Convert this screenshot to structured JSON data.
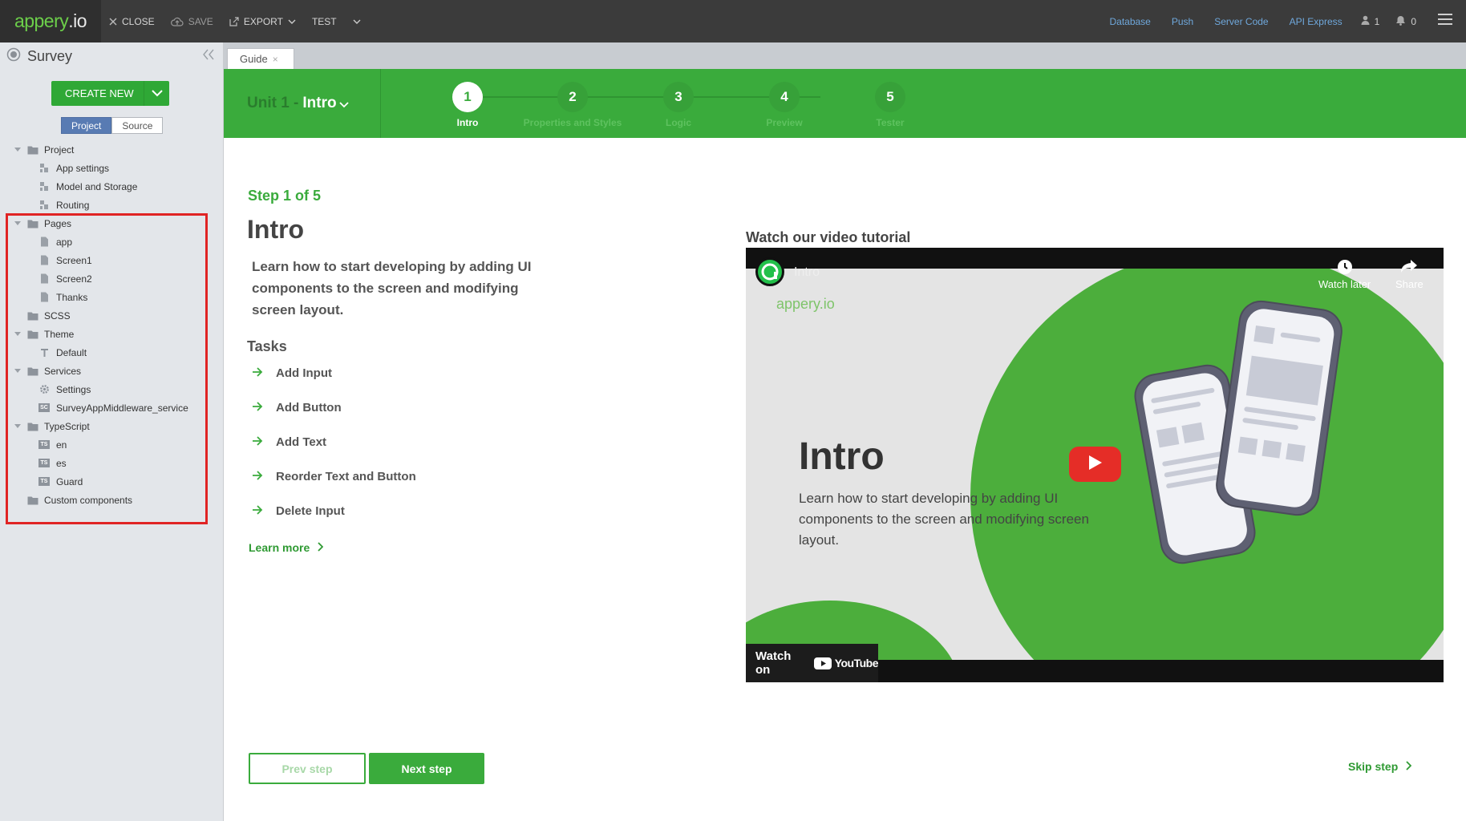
{
  "topbar": {
    "logo_main": "appery",
    "logo_dot": ".io",
    "close_label": "CLOSE",
    "save_label": "SAVE",
    "export_label": "EXPORT",
    "test_label": "TEST",
    "links": [
      "Database",
      "Push",
      "Server Code",
      "API Express"
    ],
    "user_count": "1",
    "notif_count": "0"
  },
  "sidebar": {
    "project_name": "Survey",
    "create_label": "CREATE NEW",
    "seg_project": "Project",
    "seg_source": "Source",
    "tree": [
      {
        "label": "Project",
        "level": 0,
        "icon": "folder-icon",
        "toggle": true
      },
      {
        "label": "App settings",
        "level": 1,
        "icon": "settings-file-icon"
      },
      {
        "label": "Model and Storage",
        "level": 1,
        "icon": "settings-file-icon"
      },
      {
        "label": "Routing",
        "level": 1,
        "icon": "settings-file-icon"
      },
      {
        "label": "Pages",
        "level": 0,
        "icon": "folder-icon",
        "toggle": true
      },
      {
        "label": "app",
        "level": 1,
        "icon": "page-icon"
      },
      {
        "label": "Screen1",
        "level": 1,
        "icon": "page-icon"
      },
      {
        "label": "Screen2",
        "level": 1,
        "icon": "page-icon"
      },
      {
        "label": "Thanks",
        "level": 1,
        "icon": "page-icon"
      },
      {
        "label": "SCSS",
        "level": 0,
        "icon": "folder-icon"
      },
      {
        "label": "Theme",
        "level": 0,
        "icon": "folder-icon",
        "toggle": true
      },
      {
        "label": "Default",
        "level": 1,
        "icon": "theme-icon"
      },
      {
        "label": "Services",
        "level": 0,
        "icon": "folder-icon",
        "toggle": true
      },
      {
        "label": "Settings",
        "level": 1,
        "icon": "gear-icon"
      },
      {
        "label": "SurveyAppMiddleware_service",
        "level": 1,
        "icon": "service-icon",
        "badge": "SC"
      },
      {
        "label": "TypeScript",
        "level": 0,
        "icon": "folder-icon",
        "toggle": true
      },
      {
        "label": "en",
        "level": 1,
        "icon": "typescript-icon",
        "badge": "TS"
      },
      {
        "label": "es",
        "level": 1,
        "icon": "typescript-icon",
        "badge": "TS"
      },
      {
        "label": "Guard",
        "level": 1,
        "icon": "typescript-icon",
        "badge": "TS"
      },
      {
        "label": "Custom components",
        "level": 0,
        "icon": "folder-icon"
      }
    ]
  },
  "tabs": [
    {
      "label": "Guide",
      "close": "×"
    }
  ],
  "guide": {
    "unit_prefix": "Unit 1 -",
    "unit_name": "Intro",
    "steps": [
      {
        "num": "1",
        "label": "Intro",
        "active": true
      },
      {
        "num": "2",
        "label": "Properties and Styles"
      },
      {
        "num": "3",
        "label": "Logic"
      },
      {
        "num": "4",
        "label": "Preview"
      },
      {
        "num": "5",
        "label": "Tester"
      }
    ],
    "step_of": "Step 1 of 5",
    "title": "Intro",
    "description": "Learn how to start developing by adding UI components to the screen and modifying screen layout.",
    "tasks_heading": "Tasks",
    "tasks": [
      "Add Input",
      "Add Button",
      "Add Text",
      "Reorder Text and Button",
      "Delete Input"
    ],
    "learn_more": "Learn more",
    "video_heading": "Watch our video tutorial",
    "prev_label": "Prev step",
    "next_label": "Next step",
    "skip_label": "Skip step"
  },
  "video": {
    "channel_title": "Intro",
    "brand": "appery.io",
    "watch_later": "Watch later",
    "share": "Share",
    "big_title": "Intro",
    "subtitle": "Learn how to start developing by adding UI components to the screen and modifying screen layout.",
    "watch_on": "Watch on",
    "youtube": "YouTube"
  },
  "colors": {
    "brand_green": "#3aab3c",
    "topbar": "#3b3b3b",
    "link_blue": "#6fa8dc",
    "highlight_red": "#e02424",
    "play_red": "#e52d27"
  }
}
